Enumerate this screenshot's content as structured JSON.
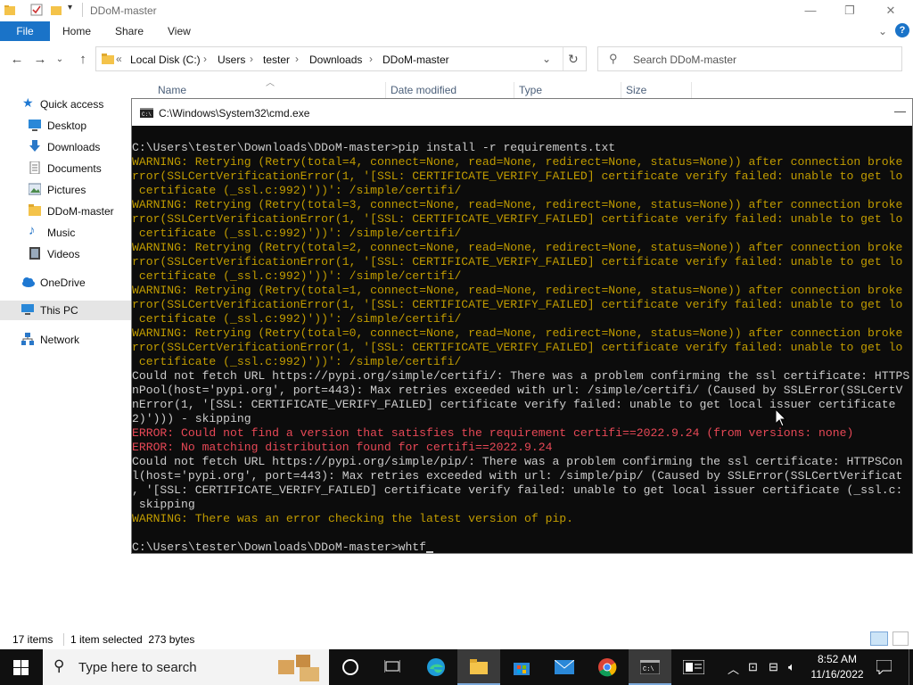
{
  "explorer": {
    "title": "DDoM-master",
    "ribbon_tabs": [
      "File",
      "Home",
      "Share",
      "View"
    ],
    "breadcrumb": [
      "Local Disk (C:)",
      "Users",
      "tester",
      "Downloads",
      "DDoM-master"
    ],
    "search_placeholder": "Search DDoM-master",
    "columns": [
      "Name",
      "Date modified",
      "Type",
      "Size"
    ],
    "sidebar": [
      {
        "label": "Quick access",
        "icon": "star-icon"
      },
      {
        "label": "Desktop",
        "icon": "desktop-icon"
      },
      {
        "label": "Downloads",
        "icon": "download-icon"
      },
      {
        "label": "Documents",
        "icon": "documents-icon"
      },
      {
        "label": "Pictures",
        "icon": "pictures-icon"
      },
      {
        "label": "DDoM-master",
        "icon": "folder-icon"
      },
      {
        "label": "Music",
        "icon": "music-icon"
      },
      {
        "label": "Videos",
        "icon": "videos-icon"
      },
      {
        "label": "OneDrive",
        "icon": "cloud-icon"
      },
      {
        "label": "This PC",
        "icon": "pc-icon"
      },
      {
        "label": "Network",
        "icon": "network-icon"
      }
    ],
    "status": {
      "items": "17 items",
      "selected": "1 item selected  273 bytes"
    }
  },
  "cmd": {
    "title": "C:\\Windows\\System32\\cmd.exe",
    "lines": [
      {
        "c": "g",
        "t": "C:\\Users\\tester\\Downloads\\DDoM-master>pip install -r requirements.txt"
      },
      {
        "c": "w",
        "t": "WARNING: Retrying (Retry(total=4, connect=None, read=None, redirect=None, status=None)) after connection broke"
      },
      {
        "c": "w",
        "t": "rror(SSLCertVerificationError(1, '[SSL: CERTIFICATE_VERIFY_FAILED] certificate verify failed: unable to get lo"
      },
      {
        "c": "w",
        "t": " certificate (_ssl.c:992)'))': /simple/certifi/"
      },
      {
        "c": "w",
        "t": "WARNING: Retrying (Retry(total=3, connect=None, read=None, redirect=None, status=None)) after connection broke"
      },
      {
        "c": "w",
        "t": "rror(SSLCertVerificationError(1, '[SSL: CERTIFICATE_VERIFY_FAILED] certificate verify failed: unable to get lo"
      },
      {
        "c": "w",
        "t": " certificate (_ssl.c:992)'))': /simple/certifi/"
      },
      {
        "c": "w",
        "t": "WARNING: Retrying (Retry(total=2, connect=None, read=None, redirect=None, status=None)) after connection broke"
      },
      {
        "c": "w",
        "t": "rror(SSLCertVerificationError(1, '[SSL: CERTIFICATE_VERIFY_FAILED] certificate verify failed: unable to get lo"
      },
      {
        "c": "w",
        "t": " certificate (_ssl.c:992)'))': /simple/certifi/"
      },
      {
        "c": "w",
        "t": "WARNING: Retrying (Retry(total=1, connect=None, read=None, redirect=None, status=None)) after connection broke"
      },
      {
        "c": "w",
        "t": "rror(SSLCertVerificationError(1, '[SSL: CERTIFICATE_VERIFY_FAILED] certificate verify failed: unable to get lo"
      },
      {
        "c": "w",
        "t": " certificate (_ssl.c:992)'))': /simple/certifi/"
      },
      {
        "c": "w",
        "t": "WARNING: Retrying (Retry(total=0, connect=None, read=None, redirect=None, status=None)) after connection broke"
      },
      {
        "c": "w",
        "t": "rror(SSLCertVerificationError(1, '[SSL: CERTIFICATE_VERIFY_FAILED] certificate verify failed: unable to get lo"
      },
      {
        "c": "w",
        "t": " certificate (_ssl.c:992)'))': /simple/certifi/"
      },
      {
        "c": "g",
        "t": "Could not fetch URL https://pypi.org/simple/certifi/: There was a problem confirming the ssl certificate: HTTPS"
      },
      {
        "c": "g",
        "t": "nPool(host='pypi.org', port=443): Max retries exceeded with url: /simple/certifi/ (Caused by SSLError(SSLCertV"
      },
      {
        "c": "g",
        "t": "nError(1, '[SSL: CERTIFICATE_VERIFY_FAILED] certificate verify failed: unable to get local issuer certificate"
      },
      {
        "c": "g",
        "t": "2)'))) - skipping"
      },
      {
        "c": "r",
        "t": "ERROR: Could not find a version that satisfies the requirement certifi==2022.9.24 (from versions: none)"
      },
      {
        "c": "r",
        "t": "ERROR: No matching distribution found for certifi==2022.9.24"
      },
      {
        "c": "g",
        "t": "Could not fetch URL https://pypi.org/simple/pip/: There was a problem confirming the ssl certificate: HTTPSCon"
      },
      {
        "c": "g",
        "t": "l(host='pypi.org', port=443): Max retries exceeded with url: /simple/pip/ (Caused by SSLError(SSLCertVerificat"
      },
      {
        "c": "g",
        "t": ", '[SSL: CERTIFICATE_VERIFY_FAILED] certificate verify failed: unable to get local issuer certificate (_ssl.c:"
      },
      {
        "c": "g",
        "t": " skipping"
      },
      {
        "c": "w",
        "t": "WARNING: There was an error checking the latest version of pip."
      },
      {
        "c": "g",
        "t": ""
      }
    ],
    "prompt": "C:\\Users\\tester\\Downloads\\DDoM-master>",
    "typed": "whtf"
  },
  "taskbar": {
    "search_placeholder": "Type here to search",
    "time": "8:52 AM",
    "date": "11/16/2022"
  }
}
